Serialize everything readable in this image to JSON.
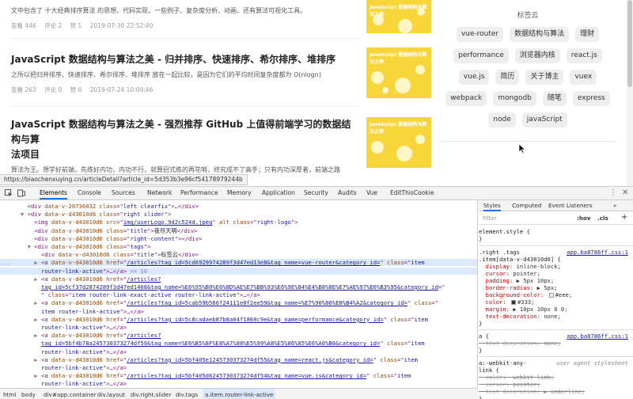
{
  "articles": [
    {
      "title": "",
      "desc": "文中包含了 十大经典排序算法 的思想、代码实现、一些例子、复杂度分析、动画、还有算法可视化工具。",
      "views": "查看 446",
      "comments": "评论 2",
      "likes": "赞 1",
      "date": "2019-07-30 22:52:40",
      "thumb_text": "JavaScript 数据结构与算法之美"
    },
    {
      "title": "JavaScript 数据结构与算法之美 - 归并排序、快速排序、希尔排序、堆排序",
      "desc": "之所以把归并排序、快速排序、希尔排序、堆排序 放在一起比较，是因为它们的平均时间复杂度都为 O(nlogn)",
      "views": "查看 263",
      "comments": "评论 0",
      "likes": "赞 0",
      "date": "2019-07-24 10:09:46",
      "thumb_text": "JavaScript 数据结构与算法之美"
    },
    {
      "title_line1": "JavaScript 数据结构与算法之美 - 强烈推荐 GitHub 上值得前端学习的数据结构与算",
      "title_line2": "法项目",
      "desc_line1": "算法为王。想学好前端，先练好内功，内功不行，就算招式练的再花哨，终究成不了高手；只有内功深厚者，前端之路",
      "desc_line2": "才会走得更远。",
      "thumb_text": "JavaScript 数据结构与算法之美"
    }
  ],
  "tag_cloud": {
    "title": "标签云",
    "tags": [
      "vue-router",
      "数据结构与算法",
      "理财",
      "performance",
      "浏览器内核",
      "react.js",
      "vue.js",
      "简历",
      "关于博主",
      "vuex",
      "webpack",
      "mongodb",
      "随笔",
      "express",
      "node",
      "javaScript"
    ]
  },
  "status_url": "https://biaochenxuying.cn/articleDetail?article_id=5d353b3e96cf54178979244b",
  "devtools": {
    "tabs": [
      "Elements",
      "Console",
      "Sources",
      "Network",
      "Performance",
      "Memory",
      "Application",
      "Security",
      "Audits",
      "Vue",
      "EditThisCookie"
    ],
    "active_tab": "Elements",
    "dom_lines": [
      {
        "indent": "        ",
        "parts": [
          [
            "tg",
            "<div "
          ],
          [
            "at",
            "data-v-20736032"
          ],
          [
            "tg",
            " "
          ],
          [
            "at",
            "class"
          ],
          [
            "tg",
            "=\""
          ],
          [
            "av",
            "left clearfix"
          ],
          [
            "tg",
            "\">…</div>"
          ]
        ]
      },
      {
        "indent": "      ▼ ",
        "parts": [
          [
            "tg",
            "<div "
          ],
          [
            "at",
            "data-v-d43010d6"
          ],
          [
            "tg",
            " "
          ],
          [
            "at",
            "class"
          ],
          [
            "tg",
            "=\""
          ],
          [
            "av",
            "right slider"
          ],
          [
            "tg",
            "\">"
          ]
        ]
      },
      {
        "indent": "          ",
        "parts": [
          [
            "tg",
            "<img "
          ],
          [
            "at",
            "data-v-d43010d6"
          ],
          [
            "tg",
            " "
          ],
          [
            "at",
            "src"
          ],
          [
            "tg",
            "=\""
          ],
          [
            "lk",
            "img/userLogo.9d2c524d.jpeg"
          ],
          [
            "tg",
            "\" "
          ],
          [
            "at",
            "alt"
          ],
          [
            "tg",
            " "
          ],
          [
            "at",
            "class"
          ],
          [
            "tg",
            "=\""
          ],
          [
            "av",
            "right-logo"
          ],
          [
            "tg",
            "\">"
          ]
        ]
      },
      {
        "indent": "          ",
        "parts": [
          [
            "tg",
            "<div "
          ],
          [
            "at",
            "data-v-d43010d6"
          ],
          [
            "tg",
            " "
          ],
          [
            "at",
            "class"
          ],
          [
            "tg",
            "=\""
          ],
          [
            "av",
            "title"
          ],
          [
            "tg",
            "\">"
          ],
          [
            "tx",
            "夜尽天明"
          ],
          [
            "tg",
            "</div>"
          ]
        ]
      },
      {
        "indent": "          ",
        "parts": [
          [
            "tg",
            "<div "
          ],
          [
            "at",
            "data-v-d43010d6"
          ],
          [
            "tg",
            " "
          ],
          [
            "at",
            "class"
          ],
          [
            "tg",
            "=\""
          ],
          [
            "av",
            "right-content"
          ],
          [
            "tg",
            "\"></div>"
          ]
        ]
      },
      {
        "indent": "        ▼ ",
        "parts": [
          [
            "tg",
            "<div "
          ],
          [
            "at",
            "data-v-d43010d6"
          ],
          [
            "tg",
            " "
          ],
          [
            "at",
            "class"
          ],
          [
            "tg",
            "=\""
          ],
          [
            "av",
            "tags"
          ],
          [
            "tg",
            "\">"
          ]
        ]
      },
      {
        "indent": "            ",
        "parts": [
          [
            "tg",
            "<div "
          ],
          [
            "at",
            "data-v-d43010d6"
          ],
          [
            "tg",
            " "
          ],
          [
            "at",
            "class"
          ],
          [
            "tg",
            "=\""
          ],
          [
            "av",
            "title"
          ],
          [
            "tg",
            "\">"
          ],
          [
            "tx",
            "标签云"
          ],
          [
            "tg",
            "</div>"
          ]
        ]
      },
      {
        "indent": "...       ▶ ",
        "hl": true,
        "parts": [
          [
            "tg",
            "<a "
          ],
          [
            "at",
            "data-v-d43010d6"
          ],
          [
            "tg",
            " "
          ],
          [
            "at",
            "href"
          ],
          [
            "tg",
            "=\""
          ],
          [
            "lk",
            "/articles?tag_id=5cd6929974289f3d47ed13e8&tag_name=vue-router&category_id="
          ],
          [
            "tg",
            "\" "
          ],
          [
            "at",
            "class"
          ],
          [
            "tg",
            "=\""
          ],
          [
            "av",
            "item"
          ]
        ]
      },
      {
        "indent": "            ",
        "hl": true,
        "parts": [
          [
            "av",
            "router-link-active"
          ],
          [
            "tg",
            "\">…</a>"
          ],
          [
            "gy",
            " == $0"
          ]
        ]
      },
      {
        "indent": "          ▶ ",
        "parts": [
          [
            "tg",
            "<a "
          ],
          [
            "at",
            "data-v-d43010d6"
          ],
          [
            "tg",
            " "
          ],
          [
            "at",
            "href"
          ],
          [
            "tg",
            "=\""
          ],
          [
            "lk",
            "/articles?"
          ]
        ]
      },
      {
        "indent": "            ",
        "parts": [
          [
            "lk",
            "tag_id=5cf37d2874289f3d47ed1468&tag_name=%E6%95%B0%E6%8D%AE%E7%BB%93%E6%9E%84%E4%B8%8E%E7%AE%97%E6%B3%95&category_id"
          ],
          [
            "tg",
            "=\""
          ]
        ]
      },
      {
        "indent": "            ",
        "parts": [
          [
            "tg",
            "\" "
          ],
          [
            "at",
            "class"
          ],
          [
            "tg",
            "=\""
          ],
          [
            "av",
            "item router-link-exact-active router-link-active"
          ],
          [
            "tg",
            "\">…</a>"
          ]
        ]
      },
      {
        "indent": "          ▶ ",
        "parts": [
          [
            "tg",
            "<a "
          ],
          [
            "at",
            "data-v-d43010d6"
          ],
          [
            "tg",
            " "
          ],
          [
            "at",
            "href"
          ],
          [
            "tg",
            "=\""
          ],
          [
            "lk",
            "/articles?tag_id=5cab59b566f24111e0f2ee59&tag_name=%E7%90%86%E8%B4%A2&category_id="
          ],
          [
            "tg",
            "\" "
          ],
          [
            "at",
            "class"
          ],
          [
            "tg",
            "=\""
          ]
        ]
      },
      {
        "indent": "            ",
        "parts": [
          [
            "av",
            "item router-link-active"
          ],
          [
            "tg",
            "\">…</a>"
          ]
        ]
      },
      {
        "indent": "          ▶ ",
        "parts": [
          [
            "tg",
            "<a "
          ],
          [
            "at",
            "data-v-d43010d6"
          ],
          [
            "tg",
            " "
          ],
          [
            "at",
            "href"
          ],
          [
            "tg",
            "=\""
          ],
          [
            "lk",
            "/articles?tag_id=5c8cadaeb87b8a04f1860c9e&tag_name=performance&category_id="
          ],
          [
            "tg",
            "\" "
          ],
          [
            "at",
            "class"
          ],
          [
            "tg",
            "=\""
          ],
          [
            "av",
            "item"
          ]
        ]
      },
      {
        "indent": "            ",
        "parts": [
          [
            "av",
            "router-link-active"
          ],
          [
            "tg",
            "\">…</a>"
          ]
        ]
      },
      {
        "indent": "          ▶ ",
        "parts": [
          [
            "tg",
            "<a "
          ],
          [
            "at",
            "data-v-d43010d6"
          ],
          [
            "tg",
            " "
          ],
          [
            "at",
            "href"
          ],
          [
            "tg",
            "=\""
          ],
          [
            "lk",
            "/articles?"
          ]
        ]
      },
      {
        "indent": "            ",
        "parts": [
          [
            "lk",
            "tag_id=5bf4b78a245730373274df59&tag_name=%E6%B5%8F%E8%A7%88%E5%99%A8%E5%86%85%E6%A0%B8&category_id="
          ],
          [
            "tg",
            "\" "
          ],
          [
            "at",
            "class"
          ],
          [
            "tg",
            "=\""
          ],
          [
            "av",
            "item"
          ]
        ]
      },
      {
        "indent": "            ",
        "parts": [
          [
            "av",
            "router-link-active"
          ],
          [
            "tg",
            "\">…</a>"
          ]
        ]
      },
      {
        "indent": "          ▶ ",
        "parts": [
          [
            "tg",
            "<a "
          ],
          [
            "at",
            "data-v-d43010d6"
          ],
          [
            "tg",
            " "
          ],
          [
            "at",
            "href"
          ],
          [
            "tg",
            "=\""
          ],
          [
            "lk",
            "/articles?tag_id=5bf405e1245730373274df55&tag_name=react.js&category_id="
          ],
          [
            "tg",
            "\" "
          ],
          [
            "at",
            "class"
          ],
          [
            "tg",
            "=\""
          ],
          [
            "av",
            "item"
          ]
        ]
      },
      {
        "indent": "            ",
        "parts": [
          [
            "av",
            "router-link-active"
          ],
          [
            "tg",
            "\">…</a>"
          ]
        ]
      },
      {
        "indent": "          ▶ ",
        "parts": [
          [
            "tg",
            "<a "
          ],
          [
            "at",
            "data-v-d43010d6"
          ],
          [
            "tg",
            " "
          ],
          [
            "at",
            "href"
          ],
          [
            "tg",
            "=\""
          ],
          [
            "lk",
            "/articles?tag_id=5bf405d6245730373274df54&tag_name=vue.js&category_id="
          ],
          [
            "tg",
            "\" "
          ],
          [
            "at",
            "class"
          ],
          [
            "tg",
            "=\""
          ],
          [
            "av",
            "item"
          ]
        ]
      },
      {
        "indent": "            ",
        "parts": [
          [
            "av",
            "router-link-active"
          ],
          [
            "tg",
            "\">…</a>"
          ]
        ]
      }
    ],
    "breadcrumbs": [
      "html",
      "body",
      "div#app.container",
      "div.layout",
      "div.right.slider",
      "div.tags",
      "a.item.router-link-active"
    ],
    "styles": {
      "tabs": [
        "Styles",
        "Computed",
        "Event Listeners",
        "»"
      ],
      "filter_placeholder": "Filter",
      "hov": ":hov",
      "cls": ".cls",
      "plus": "+",
      "element_style": "element.style {",
      "close": "}",
      "rule_selector_1": ".right .tags",
      "rule_selector_2": ".item[data-v-d43010d6] {",
      "rule_source": "app.ba8786ff.css:1",
      "props": [
        {
          "name": "display",
          "value": "inline-block;"
        },
        {
          "name": "cursor",
          "value": "pointer;"
        },
        {
          "name": "padding",
          "value": "▶ 5px 10px;"
        },
        {
          "name": "border-radius",
          "value": "▶ 5px;"
        },
        {
          "name": "background-color",
          "value": "#eee;",
          "swatch": "#eeeeee"
        },
        {
          "name": "color",
          "value": "#333;",
          "swatch": "#333333"
        },
        {
          "name": "margin",
          "value": "▶ 10px 10px 0 0;"
        },
        {
          "name": "text-decoration",
          "value": "none;"
        }
      ],
      "a_selector": "a {",
      "a_source": "app.ba8786ff.css:1",
      "a_prop": {
        "name": "text-decoration",
        "value": "none;"
      },
      "ua_selector": "a:-webkit-any-",
      "ua_selector2": "link {",
      "ua_label": "user agent stylesheet",
      "ua_props": [
        {
          "name": "color",
          "value": "-webkit-link;"
        },
        {
          "name": "cursor",
          "value": "pointer;"
        },
        {
          "name": "text-decoration",
          "value": "▶ underline;"
        }
      ]
    }
  }
}
